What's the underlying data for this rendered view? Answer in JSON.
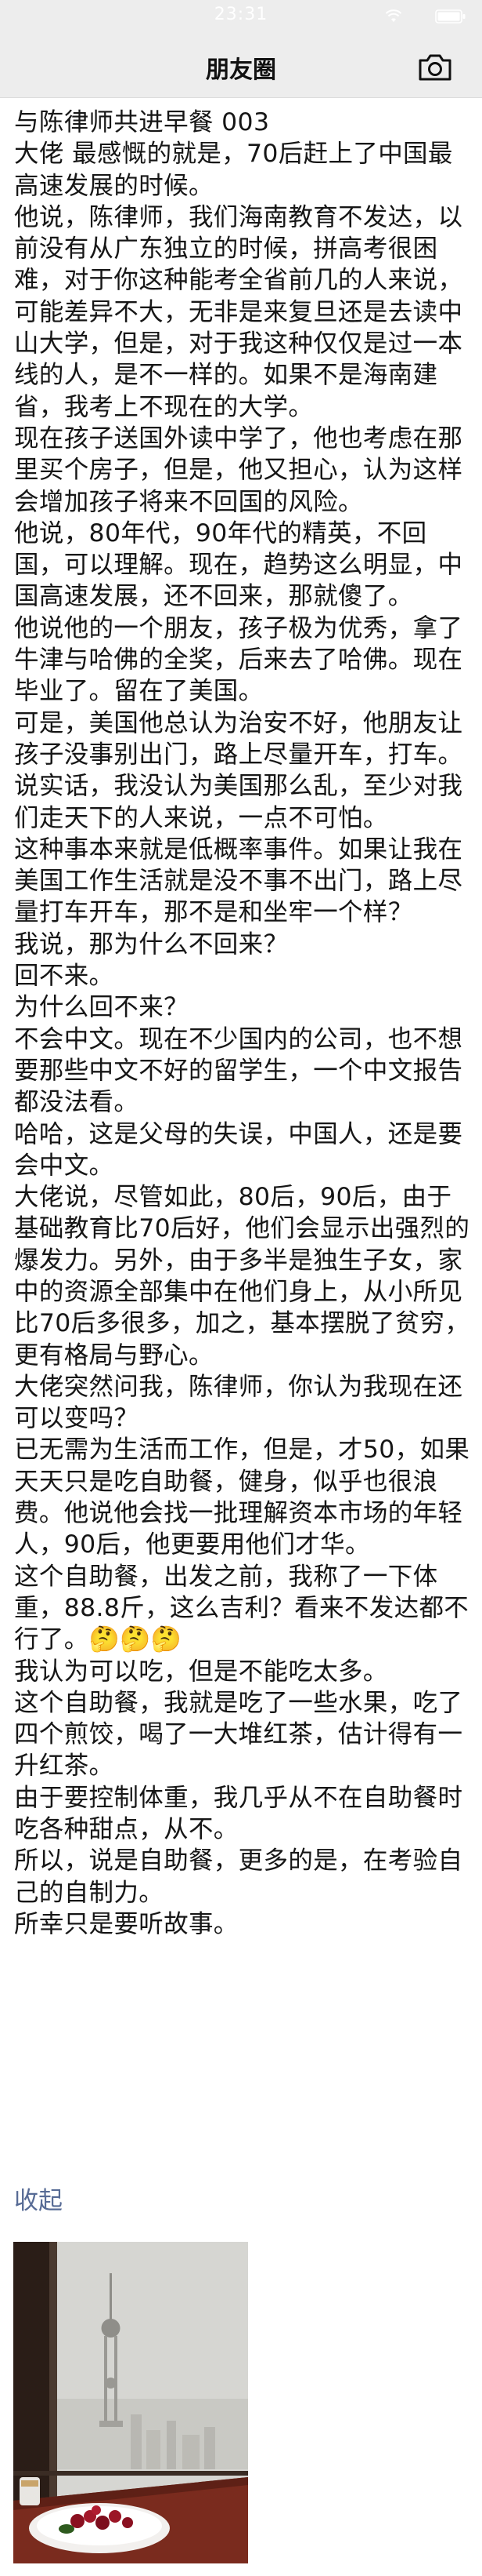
{
  "status_bar": {
    "time": "23:31",
    "icons": [
      "wifi-icon",
      "battery-icon"
    ]
  },
  "nav_bar": {
    "title": "朋友圈",
    "right_icon": "camera-icon"
  },
  "post": {
    "paragraphs": [
      "与陈律师共进早餐 003",
      "大佬 最感慨的就是，70后赶上了中国最高速发展的时候。",
      "他说，陈律师，我们海南教育不发达，以前没有从广东独立的时候，拼高考很困难，对于你这种能考全省前几的人来说，可能差异不大，无非是来复旦还是去读中山大学，但是，对于我这种仅仅是过一本线的人，是不一样的。如果不是海南建省，我考上不现在的大学。",
      "现在孩子送国外读中学了，他也考虑在那里买个房子，但是，他又担心，认为这样会增加孩子将来不回国的风险。",
      "他说，80年代，90年代的精英，不回国，可以理解。现在，趋势这么明显，中国高速发展，还不回来，那就傻了。",
      "他说他的一个朋友，孩子极为优秀，拿了牛津与哈佛的全奖，后来去了哈佛。现在毕业了。留在了美国。",
      "可是，美国他总认为治安不好，他朋友让孩子没事别出门，路上尽量开车，打车。",
      "说实话，我没认为美国那么乱，至少对我们走天下的人来说，一点不可怕。",
      "这种事本来就是低概率事件。如果让我在美国工作生活就是没不事不出门，路上尽量打车开车，那不是和坐牢一个样？",
      "我说，那为什么不回来？",
      "回不来。",
      "为什么回不来？",
      "不会中文。现在不少国内的公司，也不想要那些中文不好的留学生，一个中文报告都没法看。",
      "哈哈，这是父母的失误，中国人，还是要会中文。",
      "大佬说，尽管如此，80后，90后，由于基础教育比70后好，他们会显示出强烈的爆发力。另外，由于多半是独生子女，家中的资源全部集中在他们身上，从小所见比70后多很多，加之，基本摆脱了贫穷，更有格局与野心。",
      "大佬突然问我，陈律师，你认为我现在还可以变吗？",
      "已无需为生活而工作，但是，才50，如果天天只是吃自助餐，健身，似乎也很浪费。他说他会找一批理解资本市场的年轻人，90后，他更要用他们才华。",
      "这个自助餐，出发之前，我称了一下体重，88.8斤，这么吉利？看来不发达都不行了。🤔🤔🤔",
      "我认为可以吃，但是不能吃太多。",
      "这个自助餐，我就是吃了一些水果，吃了四个煎饺，喝了一大堆红茶，估计得有一升红茶。",
      "由于要控制体重，我几乎从不在自助餐时吃各种甜点，从不。",
      "所以，说是自助餐，更多的是，在考验自己的自制力。",
      "所幸只是要听故事。"
    ],
    "collapse_label": "收起",
    "photo": {
      "description_icon": "photo-thumbnail",
      "colors": {
        "sky": "#d6d6d2",
        "frame": "#2a1d17",
        "plate": "#f2f0ee",
        "fruit": "#8a1020",
        "table": "#7a2b1e"
      }
    }
  },
  "colors": {
    "bar_background": "#ededed",
    "link": "#576b95",
    "text": "#161616",
    "page_background": "#ffffff"
  }
}
